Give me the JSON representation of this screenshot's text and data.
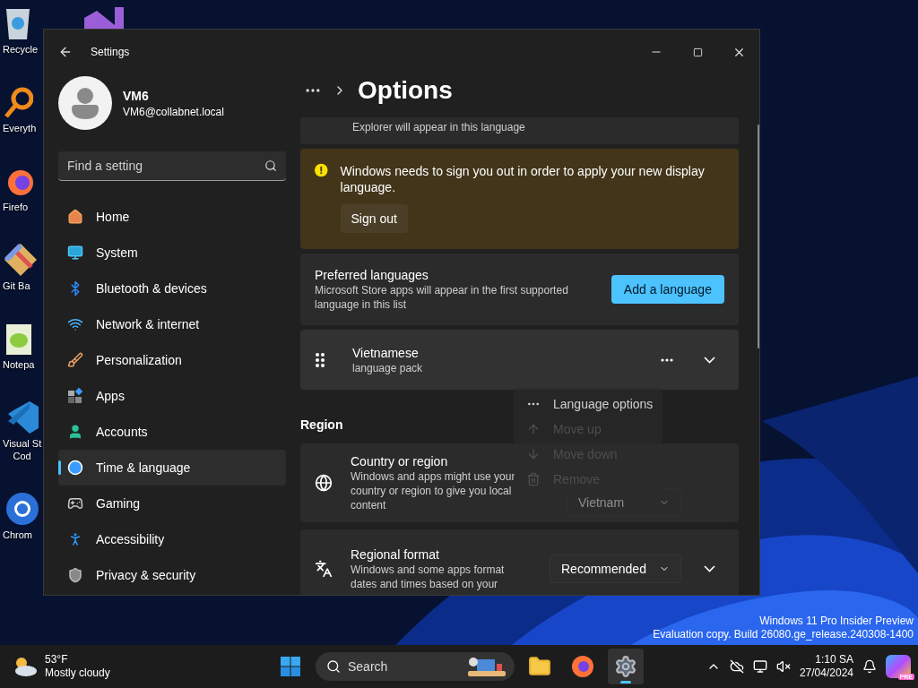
{
  "desktop": {
    "icons": [
      {
        "kind": "bin",
        "label": "Recycle"
      },
      {
        "kind": "finder",
        "label": "Everyth"
      },
      {
        "kind": "fox",
        "label": "Firefo"
      },
      {
        "kind": "git",
        "label": "Git Ba"
      },
      {
        "kind": "notepad",
        "label": "Notepa"
      },
      {
        "kind": "code",
        "label": "Visual St\nCod"
      },
      {
        "kind": "chrome",
        "label": "Chrom"
      }
    ],
    "build_info": [
      "Windows 11 Pro Insider Preview",
      "Evaluation copy. Build 26080.ge_release.240308-1400"
    ]
  },
  "window": {
    "title": "Settings"
  },
  "account": {
    "name": "VM6",
    "email": "VM6@collabnet.local"
  },
  "search": {
    "placeholder": "Find a setting"
  },
  "nav": [
    {
      "kind": "home",
      "label": "Home",
      "selected": false
    },
    {
      "kind": "system",
      "label": "System",
      "selected": false
    },
    {
      "kind": "bluetooth",
      "label": "Bluetooth & devices",
      "selected": false
    },
    {
      "kind": "network",
      "label": "Network & internet",
      "selected": false
    },
    {
      "kind": "brush",
      "label": "Personalization",
      "selected": false
    },
    {
      "kind": "apps",
      "label": "Apps",
      "selected": false
    },
    {
      "kind": "accounts",
      "label": "Accounts",
      "selected": false
    },
    {
      "kind": "time",
      "label": "Time & language",
      "selected": true
    },
    {
      "kind": "gaming",
      "label": "Gaming",
      "selected": false
    },
    {
      "kind": "accessibility",
      "label": "Accessibility",
      "selected": false
    },
    {
      "kind": "privacy",
      "label": "Privacy & security",
      "selected": false
    }
  ],
  "page": {
    "title": "Options"
  },
  "display_language": {
    "description": "Explorer will appear in this language"
  },
  "notice": {
    "message": "Windows needs to sign you out in order to apply your new display language.",
    "button": "Sign out"
  },
  "preferred": {
    "title": "Preferred languages",
    "description": "Microsoft Store apps will appear in the first supported language in this list",
    "button": "Add a language"
  },
  "language": {
    "name": "Vietnamese",
    "detail": "language pack"
  },
  "menu": [
    {
      "kind": "options",
      "label": "Language options",
      "disabled": false
    },
    {
      "kind": "up",
      "label": "Move up",
      "disabled": true
    },
    {
      "kind": "down",
      "label": "Move down",
      "disabled": true
    },
    {
      "kind": "remove",
      "label": "Remove",
      "disabled": true
    }
  ],
  "region": {
    "heading": "Region",
    "rows": [
      {
        "kind": "globe",
        "title": "Country or region",
        "description": "Windows and apps might use your country or region to give you local content",
        "value": "Vietnam",
        "expandable": false
      },
      {
        "kind": "format",
        "title": "Regional format",
        "description": "Windows and some apps format dates and times based on your",
        "value": "Recommended",
        "expandable": true
      }
    ]
  },
  "taskbar": {
    "temperature": "53°F",
    "condition": "Mostly cloudy",
    "search": "Search",
    "apps": [
      {
        "kind": "explorer",
        "selected": false
      },
      {
        "kind": "firefox",
        "selected": false
      },
      {
        "kind": "settings",
        "selected": true
      }
    ],
    "time": "1:10 SA",
    "date": "27/04/2024",
    "copilot_badge": "PRE"
  }
}
